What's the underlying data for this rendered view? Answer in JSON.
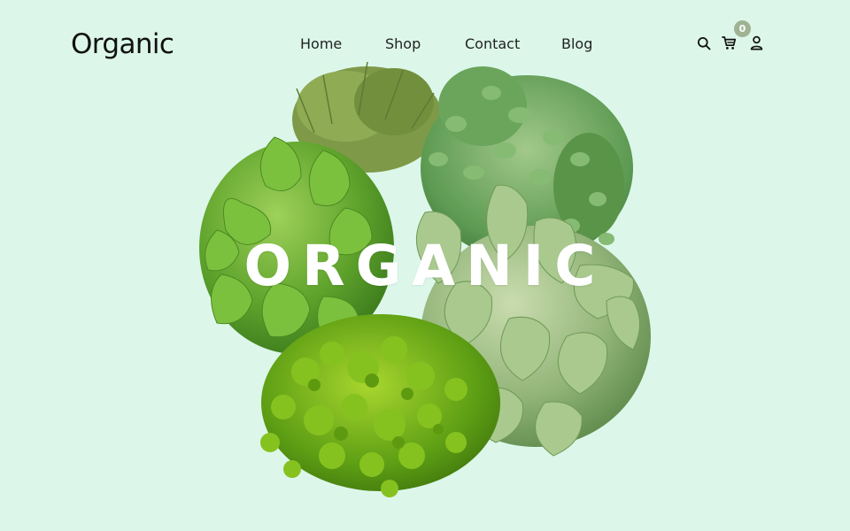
{
  "brand": {
    "logo": "Organic"
  },
  "nav": {
    "items": [
      {
        "label": "Home"
      },
      {
        "label": "Shop"
      },
      {
        "label": "Contact"
      },
      {
        "label": "Blog"
      }
    ]
  },
  "toolbar": {
    "search_icon": "search-icon",
    "cart_icon": "cart-icon",
    "user_icon": "user-icon",
    "cart_count": "0"
  },
  "hero": {
    "title": "ORGANIC",
    "image": "herb-bouquet"
  },
  "colors": {
    "background": "#dcf7ea",
    "badge": "#9fb393",
    "text": "#111111"
  }
}
